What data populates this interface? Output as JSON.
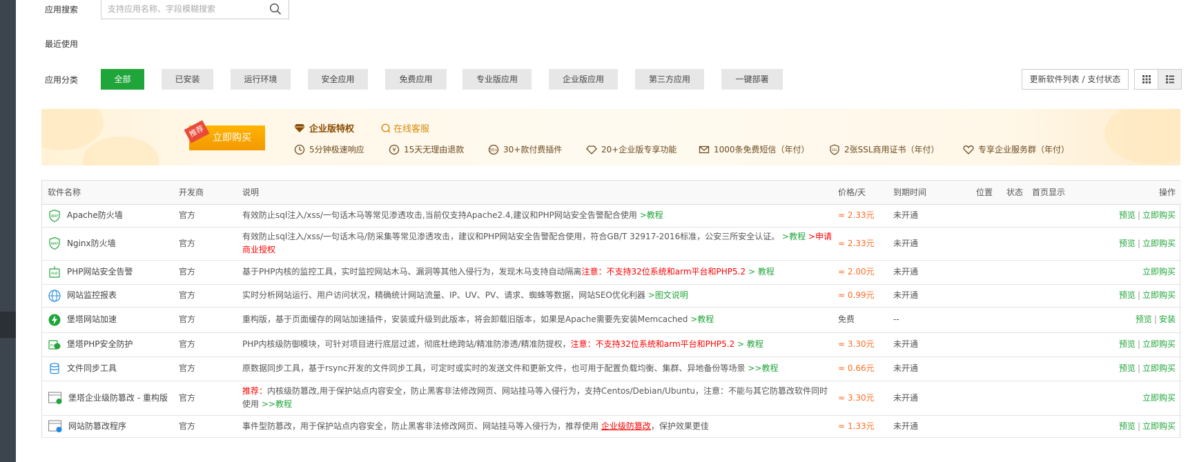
{
  "search": {
    "label": "应用搜索",
    "placeholder": "支持应用名称、字段模糊搜索"
  },
  "recent": {
    "label": "最近使用"
  },
  "categories": {
    "label": "应用分类",
    "items": [
      "全部",
      "已安装",
      "运行环境",
      "安全应用",
      "免费应用",
      "专业版应用",
      "企业版应用",
      "第三方应用",
      "一键部署"
    ]
  },
  "toolbar": {
    "update_label": "更新软件列表 / 支付状态"
  },
  "banner": {
    "tag": "推荐",
    "buy_label": "立即购买",
    "title": "企业版特权",
    "online_service": "在线客服",
    "perks": [
      "5分钟极速响应",
      "15天无理由退款",
      "30+款付费插件",
      "20+企业版专享功能",
      "1000条免费短信（年付）",
      "2张SSL商用证书（年付）",
      "专享企业服务群（年付）"
    ]
  },
  "table": {
    "headers": [
      "软件名称",
      "开发商",
      "说明",
      "价格/天",
      "到期时间",
      "位置",
      "状态",
      "首页显示",
      "操作"
    ],
    "rows": [
      {
        "name": "Apache防火墙",
        "dev": "官方",
        "desc": "有效防止sql注入/xss/一句话木马等常见渗透攻击,当前仅支持Apache2.4,建议和PHP网站安全告警配合使用",
        "link": ">教程",
        "link2": "",
        "note": "",
        "tail": "",
        "price": "≈ 2.33元",
        "expire": "未开通",
        "op1": "预览",
        "op2": "立即购买"
      },
      {
        "name": "Nginx防火墙",
        "dev": "官方",
        "desc": "有效防止sql注入/xss/一句话木马/防采集等常见渗透攻击，建议和PHP网站安全告警配合使用，符合GB/T 32917-2016标准，公安三所安全认证。",
        "link": ">教程",
        "link2": ">申请商业授权",
        "note": "",
        "tail": "",
        "price": "≈ 2.33元",
        "expire": "未开通",
        "op1": "预览",
        "op2": "立即购买"
      },
      {
        "name": "PHP网站安全告警",
        "dev": "官方",
        "desc": "基于PHP内核的监控工具，实时监控网站木马、漏洞等其他入侵行为，发现木马支持自动隔离",
        "note": "注意：不支持32位系统和arm平台和PHP5.2",
        "link": "> 教程",
        "link2": "",
        "tail": "",
        "price": "≈ 2.00元",
        "expire": "未开通",
        "op1": "",
        "op2": "立即购买"
      },
      {
        "name": "网站监控报表",
        "dev": "官方",
        "desc": "实时分析网站运行、用户访问状况，精确统计网站流量、IP、UV、PV、请求、蜘蛛等数据，网站SEO优化利器",
        "link": ">图文说明",
        "link2": "",
        "note": "",
        "tail": "",
        "price": "≈ 0.99元",
        "expire": "未开通",
        "op1": "预览",
        "op2": "立即购买"
      },
      {
        "name": "堡塔网站加速",
        "dev": "官方",
        "desc": "重构版，基于页面缓存的网站加速插件，安装或升级到此版本，将会卸载旧版本，如果是Apache需要先安装Memcached",
        "link": ">教程",
        "link2": "",
        "note": "",
        "tail": "",
        "price": "免费",
        "expire": "--",
        "op1": "预览",
        "op2": "安装"
      },
      {
        "name": "堡塔PHP安全防护",
        "dev": "官方",
        "desc": "PHP内核级防御模块，可针对项目进行底层过滤，彻底杜绝跨站/精准防渗透/精准防提权，",
        "note": "注意：不支持32位系统和arm平台和PHP5.2",
        "link": "> 教程",
        "link2": "",
        "tail": "",
        "price": "≈ 3.30元",
        "expire": "未开通",
        "op1": "预览",
        "op2": "立即购买"
      },
      {
        "name": "文件同步工具",
        "dev": "官方",
        "desc": "原数据同步工具，基于rsync开发的文件同步工具，可定时或实时的发送文件和更新文件，也可用于配置负载均衡、集群、异地备份等场景",
        "link": ">>教程",
        "link2": "",
        "note": "",
        "tail": "",
        "price": "≈ 0.66元",
        "expire": "未开通",
        "op1": "预览",
        "op2": "立即购买"
      },
      {
        "name": "堡塔企业级防篡改 - 重构版",
        "dev": "官方",
        "note": "推荐：",
        "desc": "内核级防篡改,用于保护站点内容安全，防止黑客非法修改网页、网站挂马等入侵行为，支持Centos/Debian/Ubuntu，注意：不能与其它防篡改软件同时使用",
        "link": ">>教程",
        "link2": "",
        "tail": "",
        "price": "≈ 3.30元",
        "expire": "未开通",
        "op1": "",
        "op2": "立即购买"
      },
      {
        "name": "网站防篡改程序",
        "dev": "官方",
        "desc": "事件型防篡改，用于保护站点内容安全，防止黑客非法修改网页、网站挂马等入侵行为，推荐使用",
        "note": "企业级防篡改",
        "link": "",
        "link2": "",
        "tail": "，保护效果更佳",
        "price": "≈ 1.33元",
        "expire": "未开通",
        "op1": "预览",
        "op2": "立即购买"
      }
    ]
  },
  "colors": {
    "accent": "#20a53a",
    "price": "#fc6d26",
    "warning": "#ff0000",
    "banner_btn": "#f39800"
  }
}
